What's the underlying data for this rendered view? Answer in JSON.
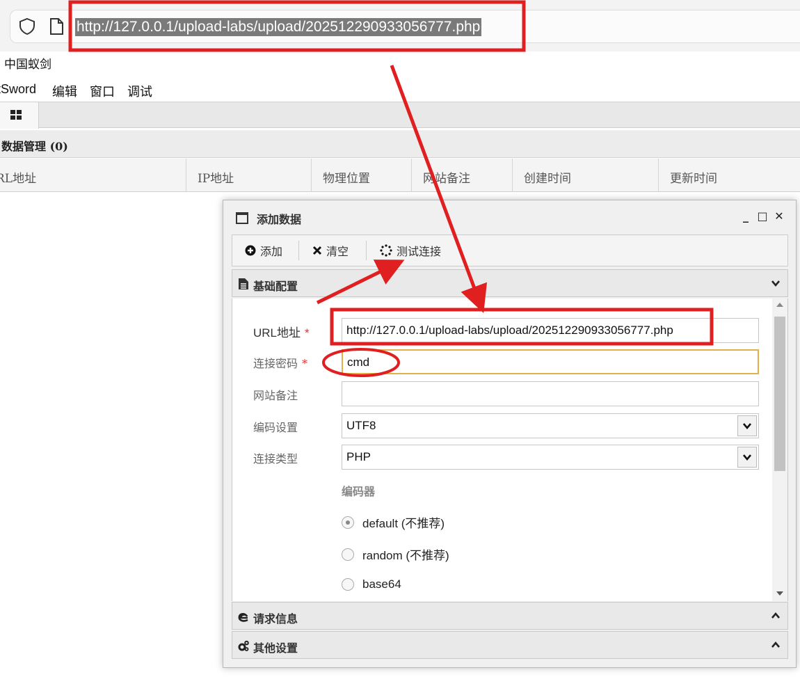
{
  "browser": {
    "url": "http://127.0.0.1/upload-labs/upload/202512290933056777.php"
  },
  "app": {
    "title": "中国蚁剑",
    "menu": [
      "tSword",
      "编辑",
      "窗口",
      "调试"
    ]
  },
  "data_panel": {
    "header": "数据管理 (0)",
    "columns": [
      "RL地址",
      "IP地址",
      "物理位置",
      "网站备注",
      "创建时间",
      "更新时间"
    ]
  },
  "dialog": {
    "title": "添加数据",
    "controls": {
      "minimize": "_",
      "maximize": "□",
      "close": "✕"
    },
    "toolbar": {
      "add": "添加",
      "clear": "清空",
      "test": "测试连接"
    },
    "sections": {
      "basic": "基础配置",
      "request": "请求信息",
      "other": "其他设置"
    },
    "form": {
      "url_label": "URL地址",
      "url_value": "http://127.0.0.1/upload-labs/upload/202512290933056777.php",
      "password_label": "连接密码",
      "password_value": "cmd",
      "note_label": "网站备注",
      "note_value": "",
      "encoding_label": "编码设置",
      "encoding_value": "UTF8",
      "type_label": "连接类型",
      "type_value": "PHP",
      "required_mark": "*",
      "encoder_title": "编码器",
      "encoders": [
        "default (不推荐)",
        "random (不推荐)",
        "base64"
      ],
      "selected_encoder": "default (不推荐)"
    }
  },
  "colors": {
    "annotation": "#e02020",
    "url_highlight": "#7a7a7a",
    "focus_border": "#e2b04a"
  }
}
